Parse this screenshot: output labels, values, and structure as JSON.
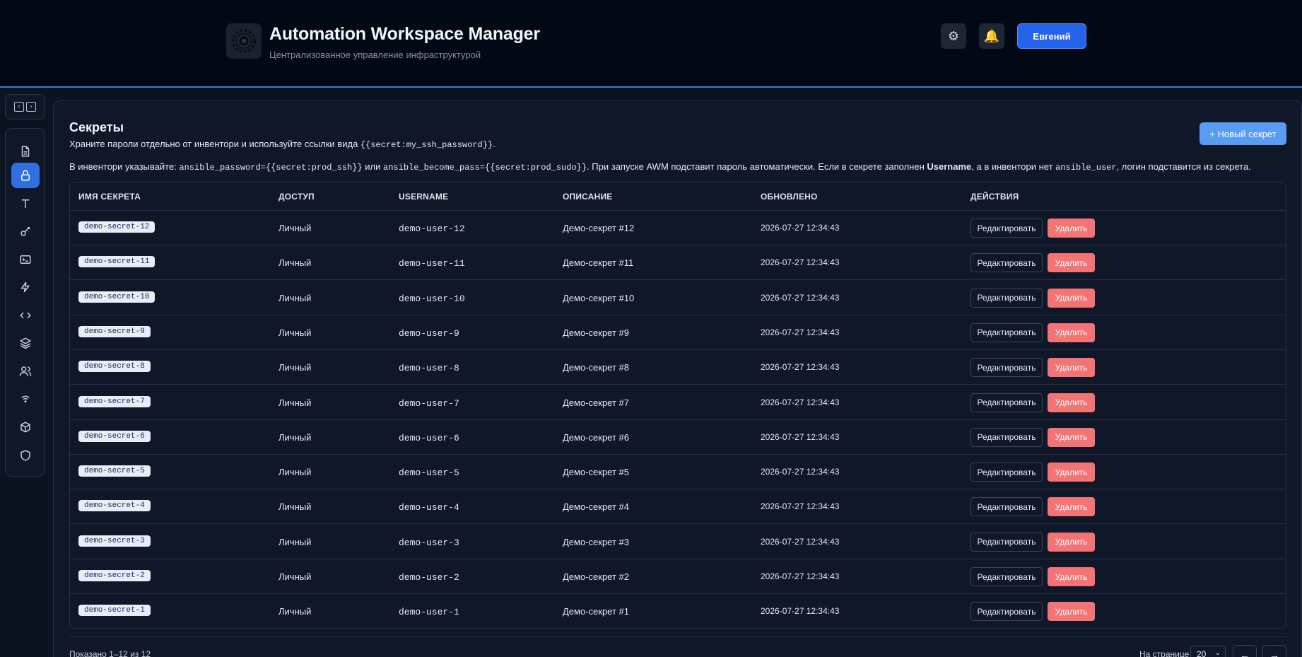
{
  "header": {
    "title": "Automation Workspace Manager",
    "subtitle": "Централизованное управление инфраструктурой",
    "logo_icon": "gear-logo-icon",
    "settings_icon": "gear-icon",
    "bell_icon": "bell-icon",
    "user_label": "Евгений"
  },
  "sidebar": {
    "items": [
      {
        "icon": "document-icon",
        "active": false
      },
      {
        "icon": "lock-icon",
        "active": true
      },
      {
        "icon": "text-icon",
        "active": false
      },
      {
        "icon": "key-icon",
        "active": false
      },
      {
        "icon": "terminal-icon",
        "active": false
      },
      {
        "icon": "lightning-icon",
        "active": false
      },
      {
        "icon": "code-icon",
        "active": false
      },
      {
        "icon": "layers-icon",
        "active": false
      },
      {
        "icon": "users-icon",
        "active": false
      },
      {
        "icon": "wifi-icon",
        "active": false
      },
      {
        "icon": "box-icon",
        "active": false
      },
      {
        "icon": "shield-icon",
        "active": false
      }
    ]
  },
  "page": {
    "title": "Секреты",
    "desc_text": "Храните пароли отдельно от инвентори и используйте ссылки вида ",
    "desc_code": "{{secret:my_ssh_password}}",
    "desc_end": ".",
    "hint_1": "В инвентори указывайте: ",
    "hint_code_1": "ansible_password={{secret:prod_ssh}}",
    "hint_2": " или ",
    "hint_code_2": "ansible_become_pass={{secret:prod_sudo}}",
    "hint_3": ". При запуске AWM подставит пароль автоматически. Если в секрете заполнен ",
    "hint_bold": "Username",
    "hint_4": ", а в инвентори нет ",
    "hint_code_3": "ansible_user",
    "hint_5": ", логин подставится из секрета.",
    "new_button": "+ Новый секрет"
  },
  "table": {
    "headers": [
      "ИМЯ СЕКРЕТА",
      "ДОСТУП",
      "USERNAME",
      "ОПИСАНИЕ",
      "ОБНОВЛЕНО",
      "ДЕЙСТВИЯ"
    ],
    "edit_label": "Редактировать",
    "delete_label": "Удалить",
    "rows": [
      {
        "name": "demo-secret-12",
        "access": "Личный",
        "username": "demo-user-12",
        "description": "Демо-секрет #12",
        "updated": "2026-07-27 12:34:43"
      },
      {
        "name": "demo-secret-11",
        "access": "Личный",
        "username": "demo-user-11",
        "description": "Демо-секрет #11",
        "updated": "2026-07-27 12:34:43"
      },
      {
        "name": "demo-secret-10",
        "access": "Личный",
        "username": "demo-user-10",
        "description": "Демо-секрет #10",
        "updated": "2026-07-27 12:34:43"
      },
      {
        "name": "demo-secret-9",
        "access": "Личный",
        "username": "demo-user-9",
        "description": "Демо-секрет #9",
        "updated": "2026-07-27 12:34:43"
      },
      {
        "name": "demo-secret-8",
        "access": "Личный",
        "username": "demo-user-8",
        "description": "Демо-секрет #8",
        "updated": "2026-07-27 12:34:43"
      },
      {
        "name": "demo-secret-7",
        "access": "Личный",
        "username": "demo-user-7",
        "description": "Демо-секрет #7",
        "updated": "2026-07-27 12:34:43"
      },
      {
        "name": "demo-secret-6",
        "access": "Личный",
        "username": "demo-user-6",
        "description": "Демо-секрет #6",
        "updated": "2026-07-27 12:34:43"
      },
      {
        "name": "demo-secret-5",
        "access": "Личный",
        "username": "demo-user-5",
        "description": "Демо-секрет #5",
        "updated": "2026-07-27 12:34:43"
      },
      {
        "name": "demo-secret-4",
        "access": "Личный",
        "username": "demo-user-4",
        "description": "Демо-секрет #4",
        "updated": "2026-07-27 12:34:43"
      },
      {
        "name": "demo-secret-3",
        "access": "Личный",
        "username": "demo-user-3",
        "description": "Демо-секрет #3",
        "updated": "2026-07-27 12:34:43"
      },
      {
        "name": "demo-secret-2",
        "access": "Личный",
        "username": "demo-user-2",
        "description": "Демо-секрет #2",
        "updated": "2026-07-27 12:34:43"
      },
      {
        "name": "demo-secret-1",
        "access": "Личный",
        "username": "demo-user-1",
        "description": "Демо-секрет #1",
        "updated": "2026-07-27 12:34:43"
      }
    ]
  },
  "footer": {
    "shown": "Показано 1–12 из 12",
    "per_page_label": "На странице",
    "per_page_value": "20",
    "prev_icon": "arrow-left-icon",
    "next_icon": "arrow-right-icon",
    "prev_glyph": "←",
    "next_glyph": "→"
  },
  "colors": {
    "accent": "#2563eb",
    "danger": "#f27474",
    "background": "#0b1220"
  }
}
